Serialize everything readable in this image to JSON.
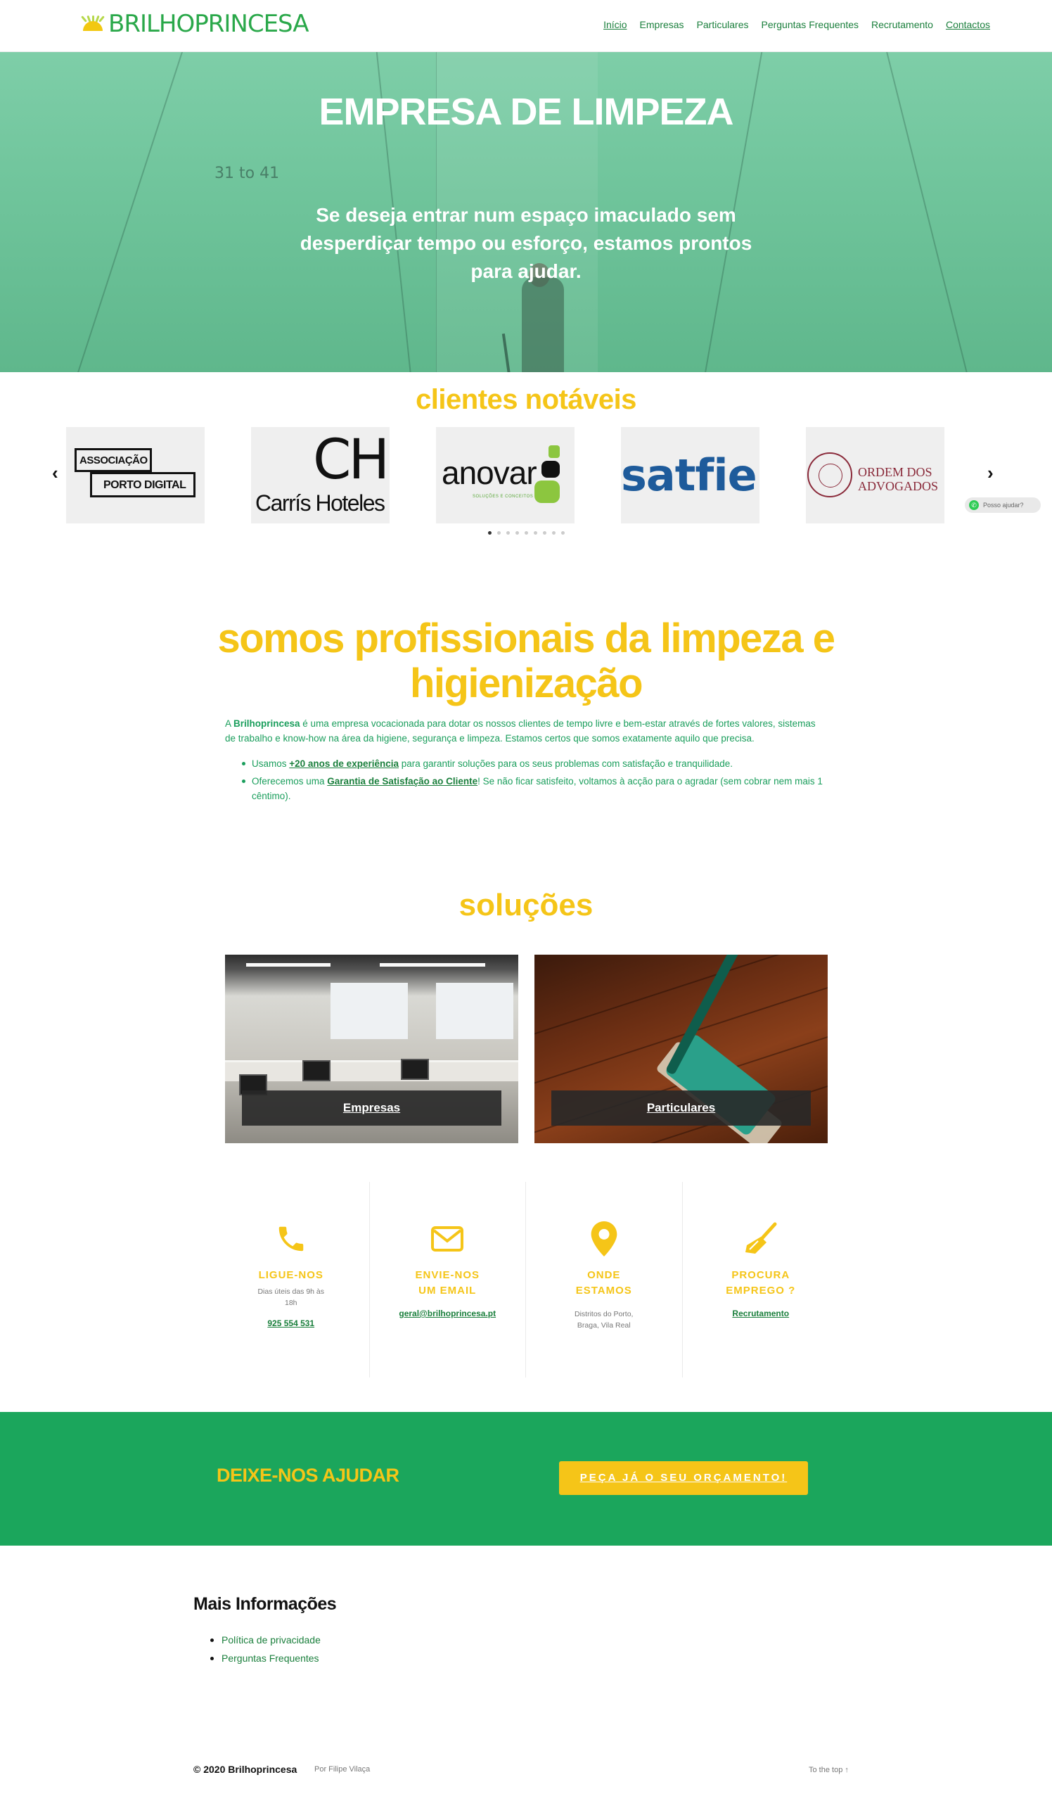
{
  "header": {
    "logo_text": "BRILHOPRINCESA",
    "nav": [
      {
        "label": "Início"
      },
      {
        "label": "Empresas"
      },
      {
        "label": "Particulares"
      },
      {
        "label": "Perguntas Frequentes"
      },
      {
        "label": "Recrutamento"
      },
      {
        "label": "Contactos"
      }
    ]
  },
  "hero": {
    "title": "EMPRESA DE LIMPEZA",
    "subtitle": "Se deseja entrar num espaço imaculado sem desperdiçar tempo ou esforço, estamos prontos para ajudar.",
    "room_number": "31 to 41"
  },
  "clients": {
    "title": "clientes notáveis",
    "prev_arrow": "‹",
    "next_arrow": "›",
    "logos": {
      "assoc_line1": "ASSOCIAÇÃO",
      "assoc_line2": "PORTO DIGITAL",
      "carris_mark": "CH",
      "carris_name": "Carrís Hoteles",
      "anovar_word": "anovar",
      "anovar_sub": "SOLUÇÕES E CONCEITOS",
      "satfiel_word": "satfiel",
      "ordem_line1": "ORDEM DOS",
      "ordem_line2": "ADVOGADOS"
    },
    "dot_count": 9,
    "active_dot": 0,
    "whatsapp_label": "Posso ajudar?"
  },
  "about": {
    "title": "somos profissionais da limpeza e higienização",
    "intro_prefix": "A ",
    "intro_brand": "Brilhoprincesa",
    "intro_rest": " é uma empresa vocacionada para dotar os nossos clientes de tempo livre e bem-estar através de fortes valores, sistemas de trabalho e know-how na área da higiene, segurança e limpeza. Estamos certos que somos exatamente aquilo que precisa.",
    "bullets": [
      {
        "pre": "Usamos ",
        "link": "+20 anos de experiência",
        "post": " para garantir soluções para os seus problemas com satisfação e tranquilidade."
      },
      {
        "pre": "Oferecemos uma ",
        "link": "Garantia de Satisfação ao Cliente",
        "post": "! Se não ficar satisfeito, voltamos à acção para o agradar (sem cobrar nem mais 1 cêntimo)."
      }
    ]
  },
  "solutions": {
    "title": "soluções",
    "cards": [
      {
        "label": "Empresas"
      },
      {
        "label": "Particulares"
      }
    ]
  },
  "contacts": [
    {
      "icon": "phone-icon",
      "title": "LIGUE-NOS",
      "desc": "Dias úteis das 9h às 18h",
      "link": "925 554 531"
    },
    {
      "icon": "envelope-icon",
      "title": "ENVIE-NOS UM EMAIL",
      "desc": "",
      "link": "geral@brilhoprincesa.pt"
    },
    {
      "icon": "map-pin-icon",
      "title": "ONDE ESTAMOS",
      "desc": "Distritos do Porto, Braga, Vila Real",
      "link": ""
    },
    {
      "icon": "broom-icon",
      "title": "PROCURA EMPREGO ?",
      "desc": "",
      "link": "Recrutamento"
    }
  ],
  "cta": {
    "text": "DEIXE-NOS AJUDAR",
    "button": "PEÇA JÁ O SEU ORÇAMENTO!"
  },
  "footer": {
    "more_title": "Mais Informações",
    "links": [
      {
        "label": "Política de privacidade"
      },
      {
        "label": "Perguntas Frequentes"
      }
    ],
    "copyright": "© 2020 Brilhoprincesa",
    "byline": "Por Filipe Vilaça",
    "to_top": "To the top ↑"
  },
  "colors": {
    "brand_green": "#1ba65c",
    "brand_yellow": "#f5c518",
    "link_green": "#1a7f3c"
  }
}
